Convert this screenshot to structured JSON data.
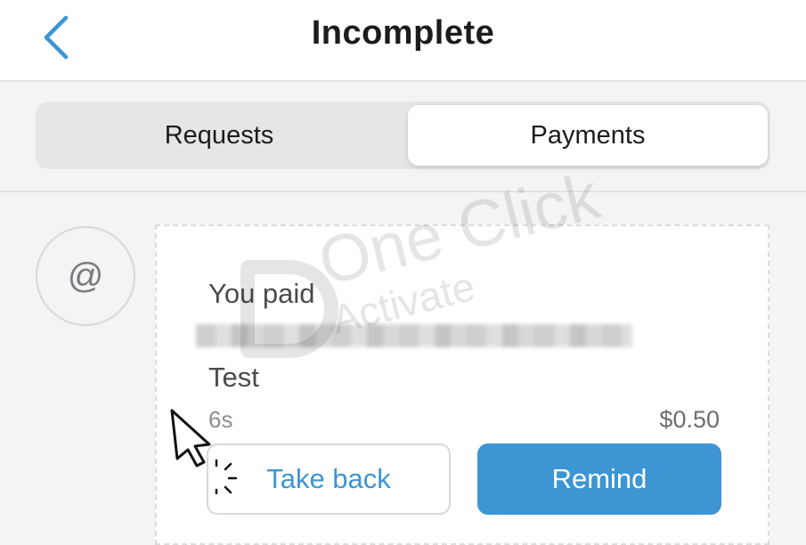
{
  "header": {
    "title": "Incomplete",
    "back_icon": "chevron-left-icon",
    "accent": "#3d95d3"
  },
  "segments": {
    "items": [
      {
        "label": "Requests",
        "selected": false
      },
      {
        "label": "Payments",
        "selected": true
      }
    ]
  },
  "transaction": {
    "avatar_symbol": "@",
    "label": "You paid",
    "note": "Test",
    "time": "6s",
    "amount": "$0.50",
    "take_back_label": "Take back",
    "remind_label": "Remind"
  },
  "watermark": {
    "line1": "One Click",
    "line2": "Activate"
  },
  "colors": {
    "primary_button": "#3d95d3",
    "background": "#f4f4f5"
  }
}
